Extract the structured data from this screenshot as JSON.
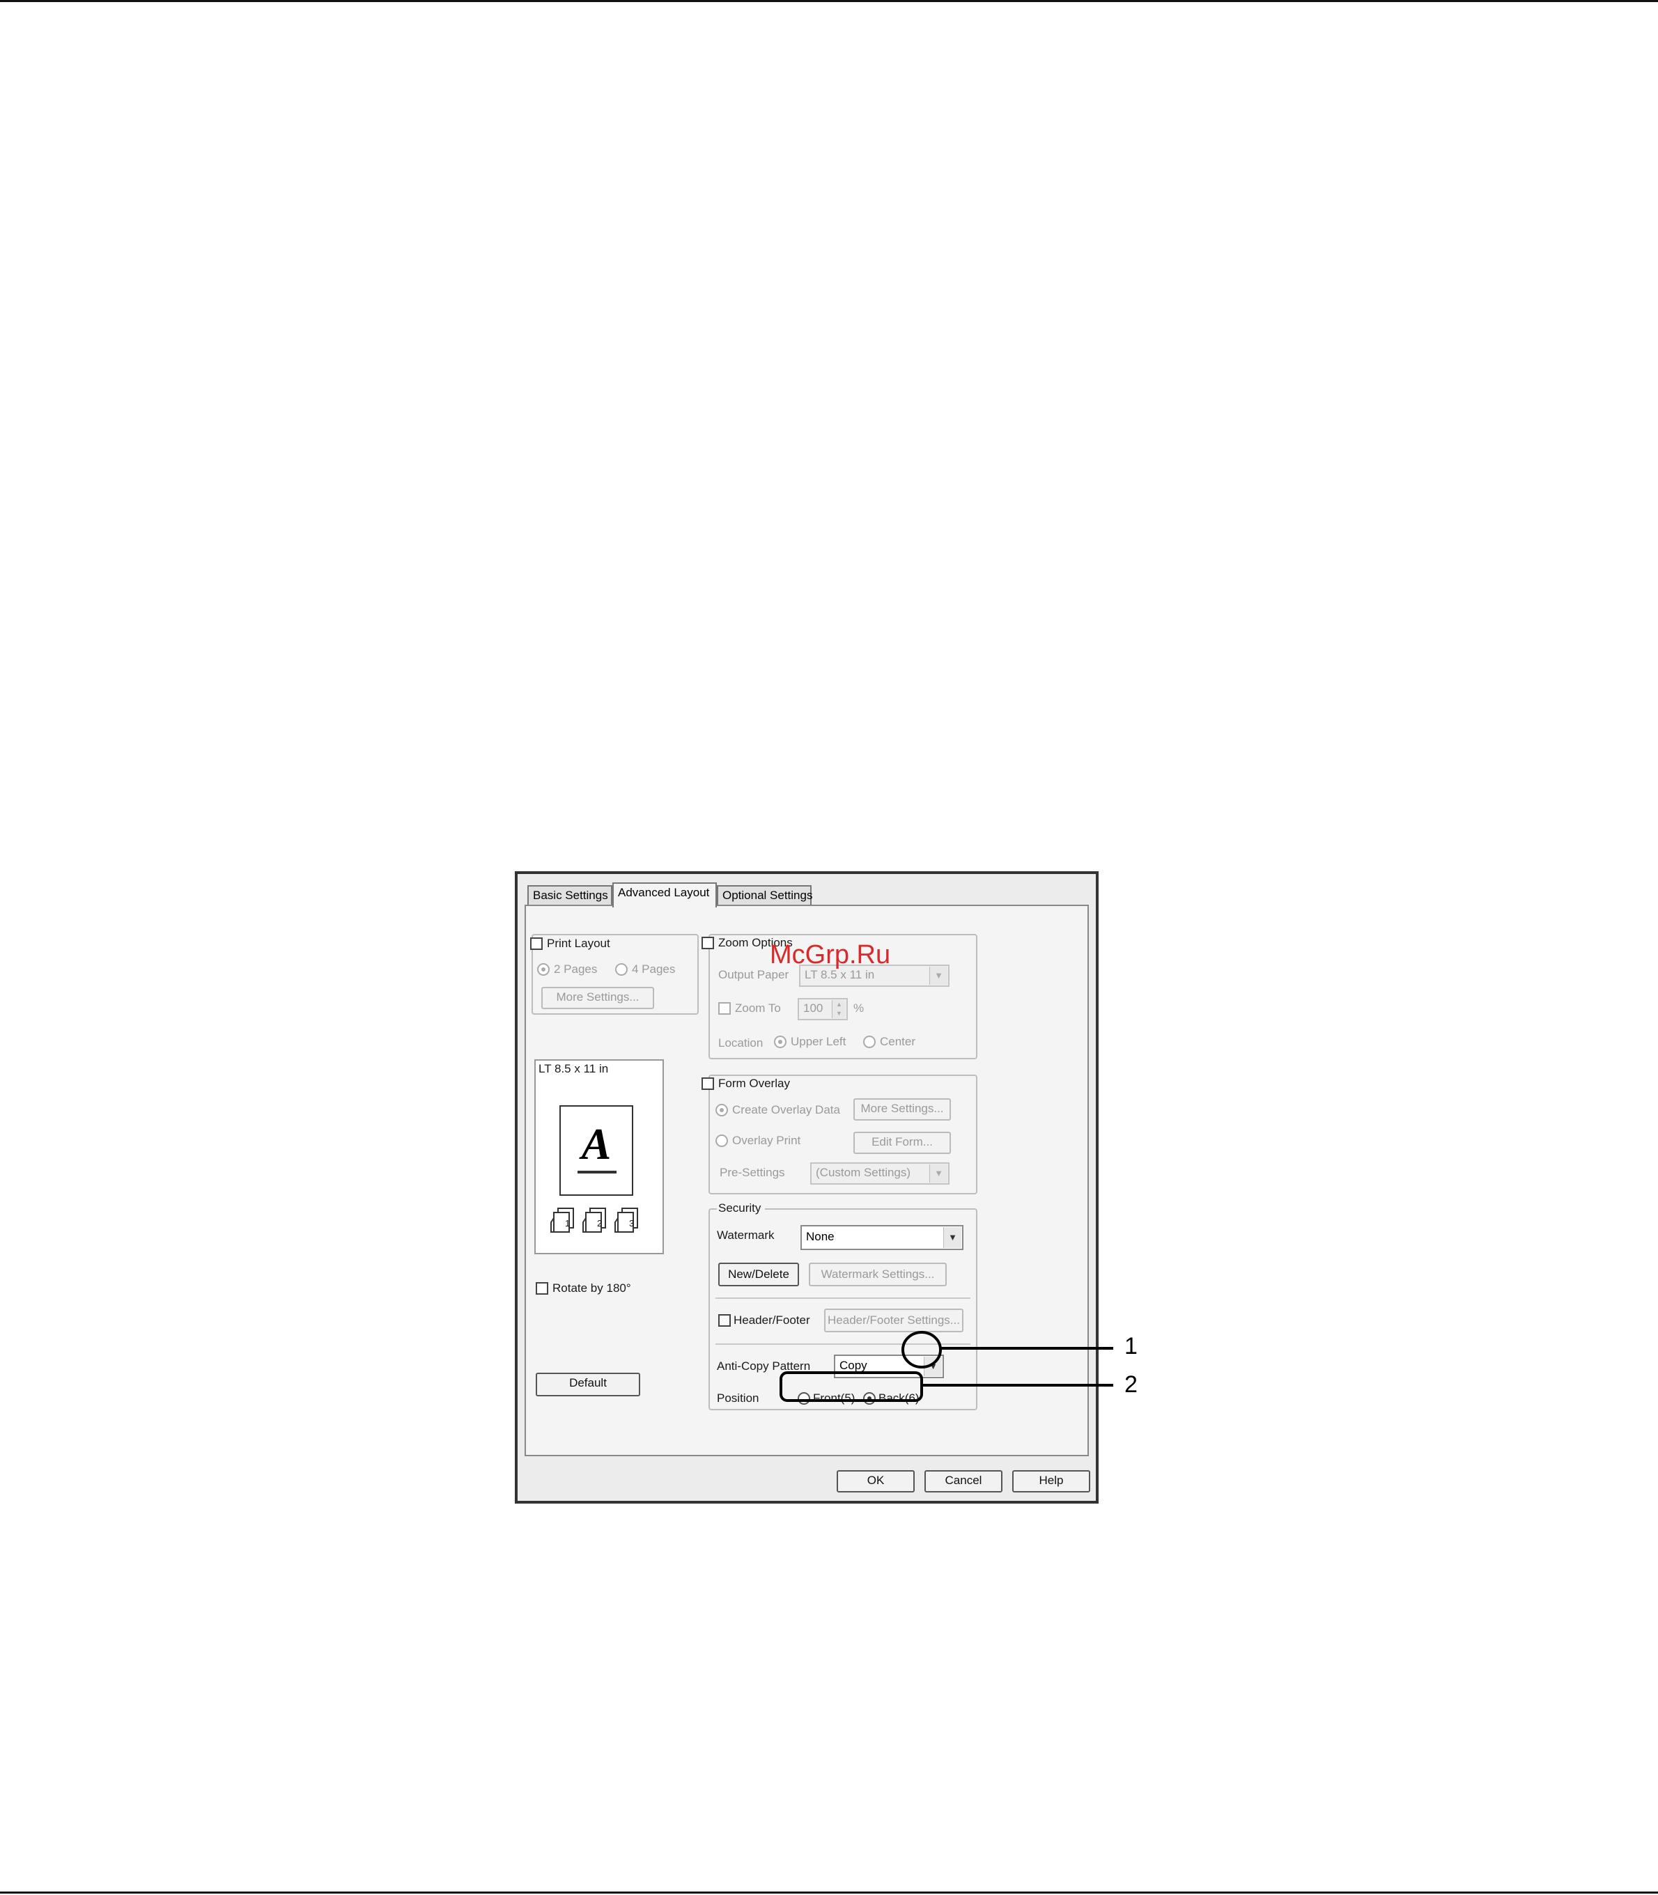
{
  "tabs": {
    "basic": "Basic Settings",
    "advanced": "Advanced Layout",
    "optional": "Optional Settings"
  },
  "watermark_text": "McGrp.Ru",
  "print_layout": {
    "label": "Print Layout",
    "opt_2pages": "2 Pages",
    "opt_4pages": "4 Pages",
    "more_settings": "More Settings..."
  },
  "preview": {
    "paper": "LT 8.5 x 11 in",
    "glyph": "A",
    "stack_labels": [
      "1",
      "2",
      "3"
    ]
  },
  "rotate": "Rotate by 180°",
  "default_button": "Default",
  "zoom": {
    "label": "Zoom Options",
    "output_paper_label": "Output Paper",
    "output_paper_value": "LT 8.5 x 11 in",
    "zoom_to_label": "Zoom To",
    "zoom_value": "100",
    "unit": "%",
    "location_label": "Location",
    "upper_left": "Upper Left",
    "center": "Center"
  },
  "form_overlay": {
    "label": "Form Overlay",
    "create_overlay": "Create Overlay Data",
    "more_settings": "More Settings...",
    "overlay_print": "Overlay Print",
    "edit_form": "Edit Form...",
    "pre_settings_label": "Pre-Settings",
    "pre_settings_value": "(Custom Settings)"
  },
  "security": {
    "label": "Security",
    "watermark_label": "Watermark",
    "watermark_value": "None",
    "new_delete": "New/Delete",
    "watermark_settings": "Watermark Settings...",
    "header_footer": "Header/Footer",
    "header_footer_settings": "Header/Footer Settings...",
    "anti_copy_label": "Anti-Copy Pattern",
    "anti_copy_value": "Copy",
    "position_label": "Position",
    "front": "Front(5)",
    "back": "Back(6)"
  },
  "footer": {
    "ok": "OK",
    "cancel": "Cancel",
    "help": "Help"
  },
  "callouts": {
    "one": "1",
    "two": "2"
  }
}
